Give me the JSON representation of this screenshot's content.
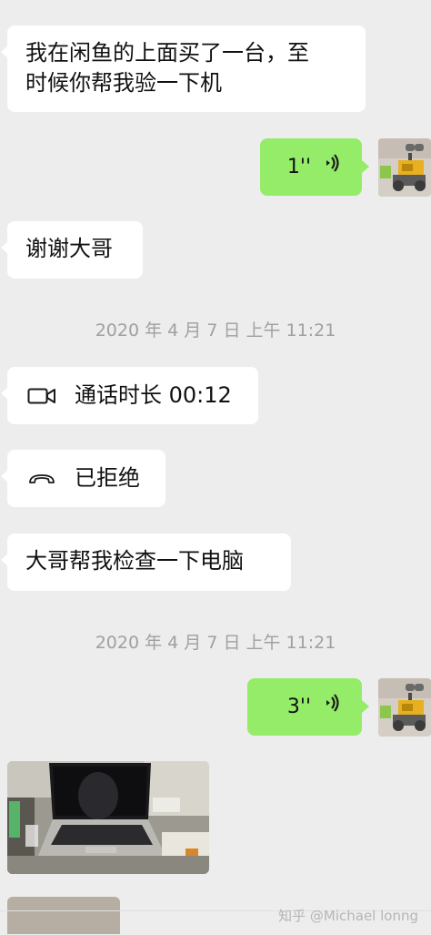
{
  "messages": {
    "m1_line1": "我在闲鱼的上面买了一台，至",
    "m1_line2": "时候你帮我验一下机",
    "voice1_duration": "1''",
    "m2": "谢谢大哥",
    "timestamp1": "2020 年 4 月 7 日  上午 11:21",
    "video_call": "通话时长 00:12",
    "rejected_call": "已拒绝",
    "m3": "大哥帮我检查一下电脑",
    "timestamp2": "2020 年 4 月 7 日  上午 11:21",
    "voice2_duration": "3''"
  },
  "watermark": "知乎 @Michael lonng",
  "colors": {
    "background": "#ededed",
    "incoming_bubble": "#ffffff",
    "outgoing_bubble": "#95ec69",
    "timestamp_text": "#a0a0a0"
  },
  "icons": {
    "voice": "voice-wave-icon",
    "video_call": "video-camera-icon",
    "phone_hangup": "phone-hangup-icon"
  }
}
